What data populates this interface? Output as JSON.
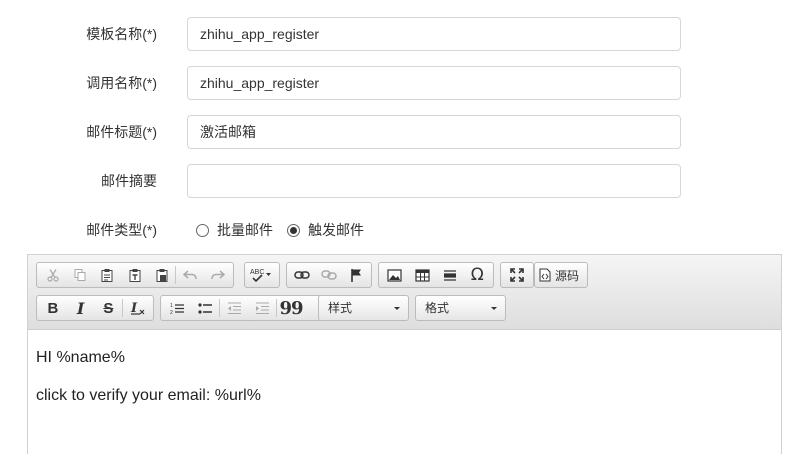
{
  "form": {
    "template_name": {
      "label": "模板名称(*)",
      "value": "zhihu_app_register"
    },
    "call_name": {
      "label": "调用名称(*)",
      "value": "zhihu_app_register"
    },
    "mail_subject": {
      "label": "邮件标题(*)",
      "value": "激活邮箱"
    },
    "mail_summary": {
      "label": "邮件摘要",
      "value": ""
    },
    "mail_type": {
      "label": "邮件类型(*)",
      "options": [
        {
          "label": "批量邮件",
          "checked": false
        },
        {
          "label": "触发邮件",
          "checked": true
        }
      ]
    }
  },
  "editor": {
    "toolbar": {
      "source_label": "源码",
      "styles_combo": "样式",
      "format_combo": "格式",
      "icons": [
        "cut-icon",
        "copy-icon",
        "paste-icon",
        "paste-text-icon",
        "paste-word-icon",
        "undo-icon",
        "redo-icon",
        "spellcheck-icon",
        "link-icon",
        "unlink-icon",
        "anchor-icon",
        "image-icon",
        "table-icon",
        "horizontal-rule-icon",
        "special-char-icon",
        "maximize-icon",
        "source-icon",
        "bold-icon",
        "italic-icon",
        "strike-icon",
        "remove-format-icon",
        "numbered-list-icon",
        "bulleted-list-icon",
        "outdent-icon",
        "indent-icon",
        "blockquote-icon"
      ],
      "glyphs": {
        "bold": "B",
        "italic": "I",
        "strike": "S",
        "omega": "Ω",
        "abc": "ABC",
        "quote": "99"
      }
    },
    "content": {
      "line1": "HI %name%",
      "line2": "click to verify your email: %url%"
    }
  }
}
